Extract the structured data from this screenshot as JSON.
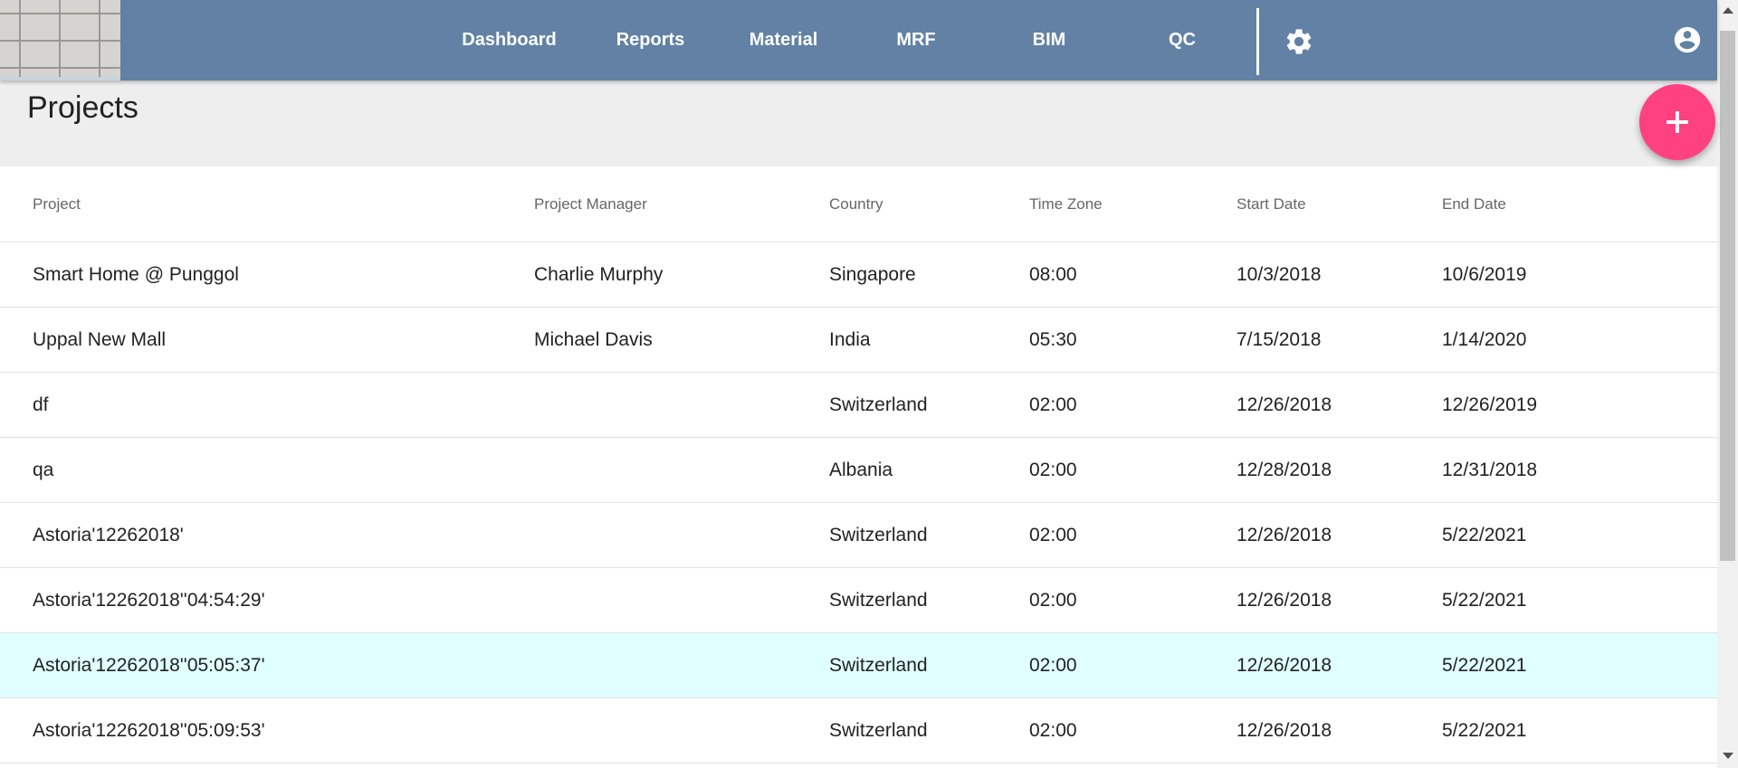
{
  "nav": {
    "items": [
      {
        "label": "Dashboard"
      },
      {
        "label": "Reports"
      },
      {
        "label": "Material"
      },
      {
        "label": "MRF"
      },
      {
        "label": "BIM"
      },
      {
        "label": "QC"
      }
    ],
    "settings_icon": "gear-icon",
    "account_icon": "account-circle-icon"
  },
  "page": {
    "title": "Projects",
    "add_icon": "plus-icon"
  },
  "table": {
    "headers": [
      "Project",
      "Project Manager",
      "Country",
      "Time Zone",
      "Start Date",
      "End Date"
    ],
    "rows": [
      [
        "Smart Home @ Punggol",
        "Charlie Murphy",
        "Singapore",
        "08:00",
        "10/3/2018",
        "10/6/2019"
      ],
      [
        "Uppal New Mall",
        "Michael Davis",
        "India",
        "05:30",
        "7/15/2018",
        "1/14/2020"
      ],
      [
        "df",
        "",
        "Switzerland",
        "02:00",
        "12/26/2018",
        "12/26/2019"
      ],
      [
        "qa",
        "",
        "Albania",
        "02:00",
        "12/28/2018",
        "12/31/2018"
      ],
      [
        "Astoria'12262018'",
        "",
        "Switzerland",
        "02:00",
        "12/26/2018",
        "5/22/2021"
      ],
      [
        "Astoria'12262018''04:54:29'",
        "",
        "Switzerland",
        "02:00",
        "12/26/2018",
        "5/22/2021"
      ],
      [
        "Astoria'12262018''05:05:37'",
        "",
        "Switzerland",
        "02:00",
        "12/26/2018",
        "5/22/2021"
      ],
      [
        "Astoria'12262018''05:09:53'",
        "",
        "Switzerland",
        "02:00",
        "12/26/2018",
        "5/22/2021"
      ]
    ]
  },
  "colors": {
    "header_bg": "#6281a5",
    "fab": "#ff4081",
    "row_highlight": "#e0ffff"
  }
}
